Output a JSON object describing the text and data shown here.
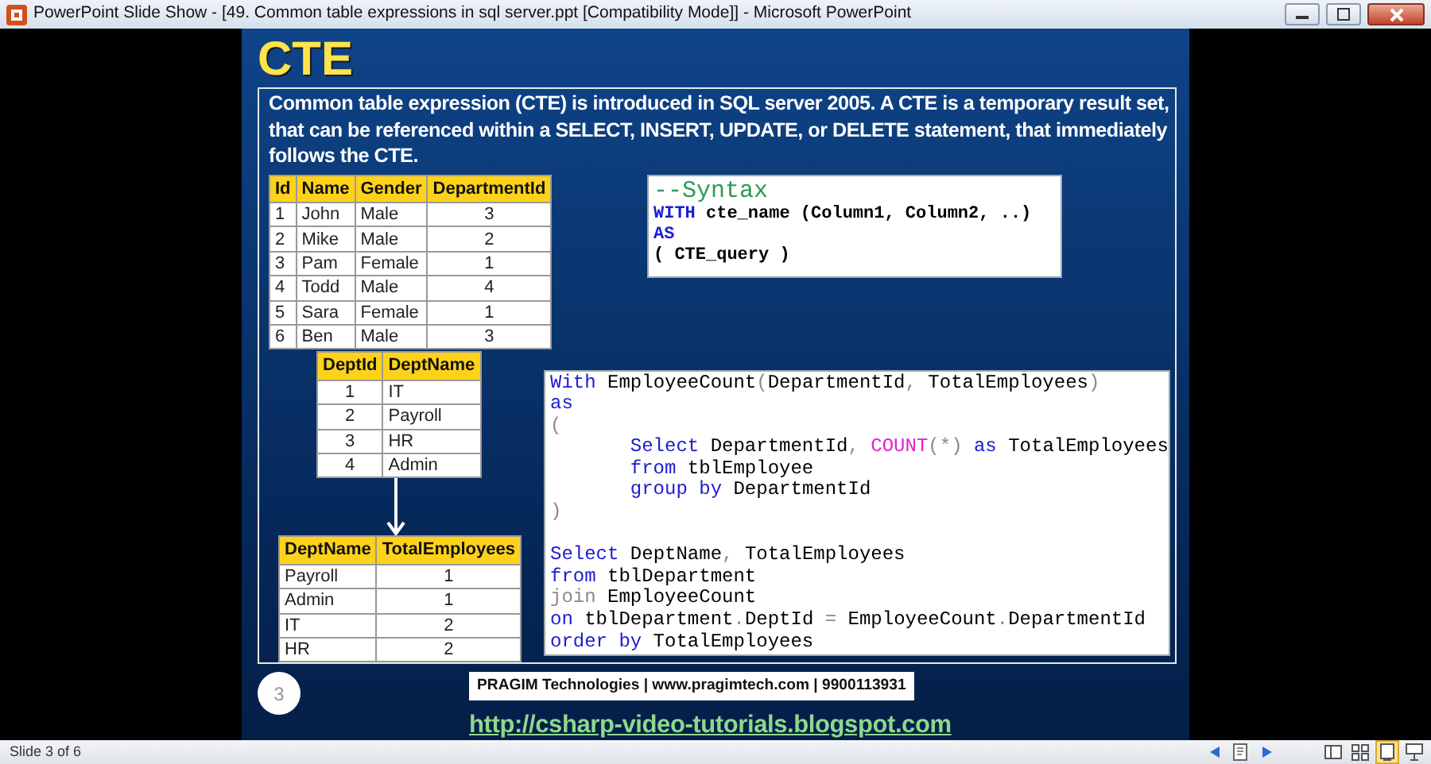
{
  "window": {
    "title": "PowerPoint Slide Show - [49. Common table expressions in sql server.ppt [Compatibility Mode]] - Microsoft PowerPoint"
  },
  "slide": {
    "title": "CTE",
    "intro": "**Common table expression (CTE)** is introduced in SQL server 2005.  A CTE is a temporary result set, that can be referenced within a SELECT, INSERT, UPDATE, or DELETE statement, that immediately follows the CTE.",
    "employee_table": {
      "columns": [
        {
          "label": "Id",
          "centered": false
        },
        {
          "label": "Name",
          "centered": false
        },
        {
          "label": "Gender",
          "centered": false
        },
        {
          "label": "DepartmentId",
          "centered": true
        }
      ],
      "rows": [
        [
          "1",
          "John",
          "Male",
          "3"
        ],
        [
          "2",
          "Mike",
          "Male",
          "2"
        ],
        [
          "3",
          "Pam",
          "Female",
          "1"
        ],
        [
          "4",
          "Todd",
          "Male",
          "4"
        ],
        [
          "5",
          "Sara",
          "Female",
          "1"
        ],
        [
          "6",
          "Ben",
          "Male",
          "3"
        ]
      ]
    },
    "department_table": {
      "columns": [
        {
          "label": "DeptId",
          "centered": true
        },
        {
          "label": "DeptName",
          "centered": false
        }
      ],
      "rows": [
        [
          "1",
          "IT"
        ],
        [
          "2",
          "Payroll"
        ],
        [
          "3",
          "HR"
        ],
        [
          "4",
          "Admin"
        ]
      ]
    },
    "result_table": {
      "columns": [
        {
          "label": "DeptName",
          "centered": false
        },
        {
          "label": "TotalEmployees",
          "centered": true
        }
      ],
      "rows": [
        [
          "Payroll",
          "1"
        ],
        [
          "Admin",
          "1"
        ],
        [
          "IT",
          "2"
        ],
        [
          "HR",
          "2"
        ]
      ]
    },
    "syntax": [
      {
        "kind": "comment",
        "tokens": [
          {
            "kind": "comment",
            "text": "--Syntax"
          }
        ]
      },
      {
        "kind": "code",
        "tokens": [
          {
            "kind": "keyword",
            "text": "WITH"
          },
          {
            "kind": "plain",
            "text": " cte_name (Column1, Column2, ..)"
          }
        ]
      },
      {
        "kind": "code",
        "tokens": [
          {
            "kind": "keyword",
            "text": "AS"
          }
        ]
      },
      {
        "kind": "code",
        "tokens": [
          {
            "kind": "plain",
            "text": "( CTE_query )"
          }
        ]
      }
    ],
    "query": [
      {
        "kind": "code",
        "tokens": [
          {
            "kind": "keyword",
            "text": "With"
          },
          {
            "kind": "plain",
            "text": " EmployeeCount"
          },
          {
            "kind": "punct",
            "text": "("
          },
          {
            "kind": "plain",
            "text": "DepartmentId"
          },
          {
            "kind": "punct",
            "text": ", "
          },
          {
            "kind": "plain",
            "text": "TotalEmployees"
          },
          {
            "kind": "punct",
            "text": ")"
          }
        ]
      },
      {
        "kind": "code",
        "tokens": [
          {
            "kind": "keyword",
            "text": "as"
          }
        ]
      },
      {
        "kind": "code",
        "tokens": [
          {
            "kind": "punct",
            "text": "("
          }
        ]
      },
      {
        "kind": "code",
        "tokens": [
          {
            "kind": "keyword",
            "text": "       Select"
          },
          {
            "kind": "plain",
            "text": " DepartmentId"
          },
          {
            "kind": "punct",
            "text": ", "
          },
          {
            "kind": "function",
            "text": "COUNT"
          },
          {
            "kind": "punct",
            "text": "(*)"
          },
          {
            "kind": "keyword",
            "text": " as"
          },
          {
            "kind": "plain",
            "text": " TotalEmployees"
          }
        ]
      },
      {
        "kind": "code",
        "tokens": [
          {
            "kind": "keyword",
            "text": "       from"
          },
          {
            "kind": "plain",
            "text": " tblEmployee"
          }
        ]
      },
      {
        "kind": "code",
        "tokens": [
          {
            "kind": "keyword",
            "text": "       group by"
          },
          {
            "kind": "plain",
            "text": " DepartmentId"
          }
        ]
      },
      {
        "kind": "code",
        "tokens": [
          {
            "kind": "punct",
            "text": ")"
          }
        ]
      },
      {
        "kind": "blank"
      },
      {
        "kind": "code",
        "tokens": [
          {
            "kind": "keyword",
            "text": "Select"
          },
          {
            "kind": "plain",
            "text": " DeptName"
          },
          {
            "kind": "punct",
            "text": ", "
          },
          {
            "kind": "plain",
            "text": "TotalEmployees"
          }
        ]
      },
      {
        "kind": "code",
        "tokens": [
          {
            "kind": "keyword",
            "text": "from"
          },
          {
            "kind": "plain",
            "text": " tblDepartment"
          }
        ]
      },
      {
        "kind": "code",
        "tokens": [
          {
            "kind": "punct",
            "text": "join"
          },
          {
            "kind": "plain",
            "text": " EmployeeCount"
          }
        ]
      },
      {
        "kind": "code",
        "tokens": [
          {
            "kind": "keyword",
            "text": "on"
          },
          {
            "kind": "plain",
            "text": " tblDepartment"
          },
          {
            "kind": "punct",
            "text": "."
          },
          {
            "kind": "plain",
            "text": "DeptId "
          },
          {
            "kind": "punct",
            "text": "="
          },
          {
            "kind": "plain",
            "text": " EmployeeCount"
          },
          {
            "kind": "punct",
            "text": "."
          },
          {
            "kind": "plain",
            "text": "DepartmentId"
          }
        ]
      },
      {
        "kind": "code",
        "tokens": [
          {
            "kind": "keyword",
            "text": "order by"
          },
          {
            "kind": "plain",
            "text": " TotalEmployees"
          }
        ]
      }
    ],
    "slide_number": "3",
    "credit": "PRAGIM Technologies | www.pragimtech.com | 9900113931",
    "link": "http://csharp-video-tutorials.blogspot.com"
  },
  "status_bar": {
    "slide_label": "Slide 3 of 6",
    "buttons": [
      {
        "kind": "previous",
        "selected": false
      },
      {
        "kind": "notes",
        "selected": false
      },
      {
        "kind": "next",
        "selected": false
      },
      {
        "kind": "normal",
        "selected": false
      },
      {
        "kind": "sorter",
        "selected": false
      },
      {
        "kind": "reading",
        "selected": true
      },
      {
        "kind": "slideshow",
        "selected": false
      }
    ]
  }
}
